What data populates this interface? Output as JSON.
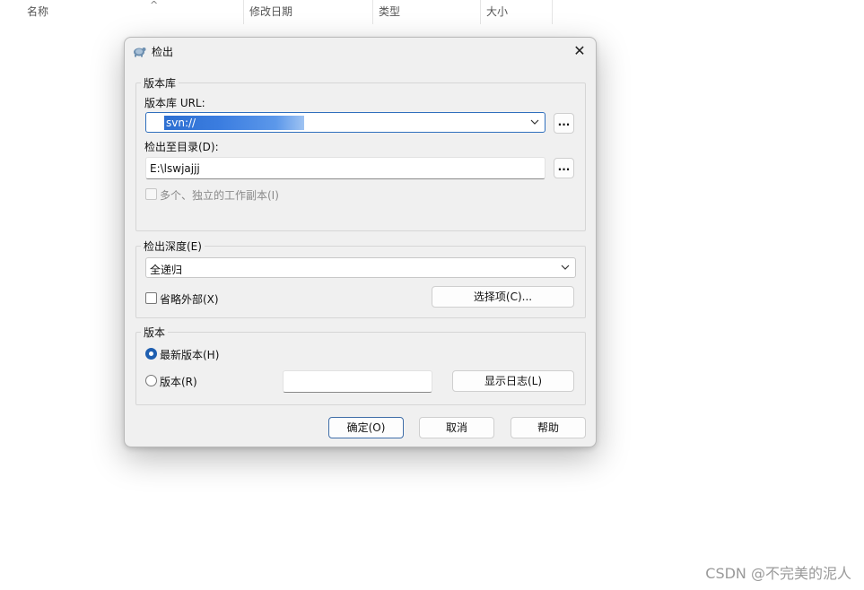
{
  "explorer": {
    "columns": [
      "名称",
      "修改日期",
      "类型",
      "大小"
    ],
    "sort_caret": "^"
  },
  "dialog": {
    "title": "检出",
    "close": "✕",
    "repository": {
      "legend": "版本库",
      "url_label": "版本库 URL:",
      "url_value": "svn://",
      "browse": "...",
      "dir_label": "检出至目录(D):",
      "dir_value": "E:\\lswjajjj",
      "dir_browse": "...",
      "multiple_label": "多个、独立的工作副本(I)"
    },
    "depth": {
      "legend": "检出深度(E)",
      "value": "全递归",
      "omit_externals": "省略外部(X)",
      "choose_items": "选择项(C)..."
    },
    "revision": {
      "legend": "版本",
      "head_label": "最新版本(H)",
      "rev_label": "版本(R)",
      "rev_value": "",
      "show_log": "显示日志(L)"
    },
    "buttons": {
      "ok": "确定(O)",
      "cancel": "取消",
      "help": "帮助"
    }
  },
  "watermark": "CSDN @不完美的泥人",
  "colors": {
    "accent": "#1f5fb0",
    "selection": "#2d6fd1",
    "dialog_bg": "#f0f0f0"
  }
}
